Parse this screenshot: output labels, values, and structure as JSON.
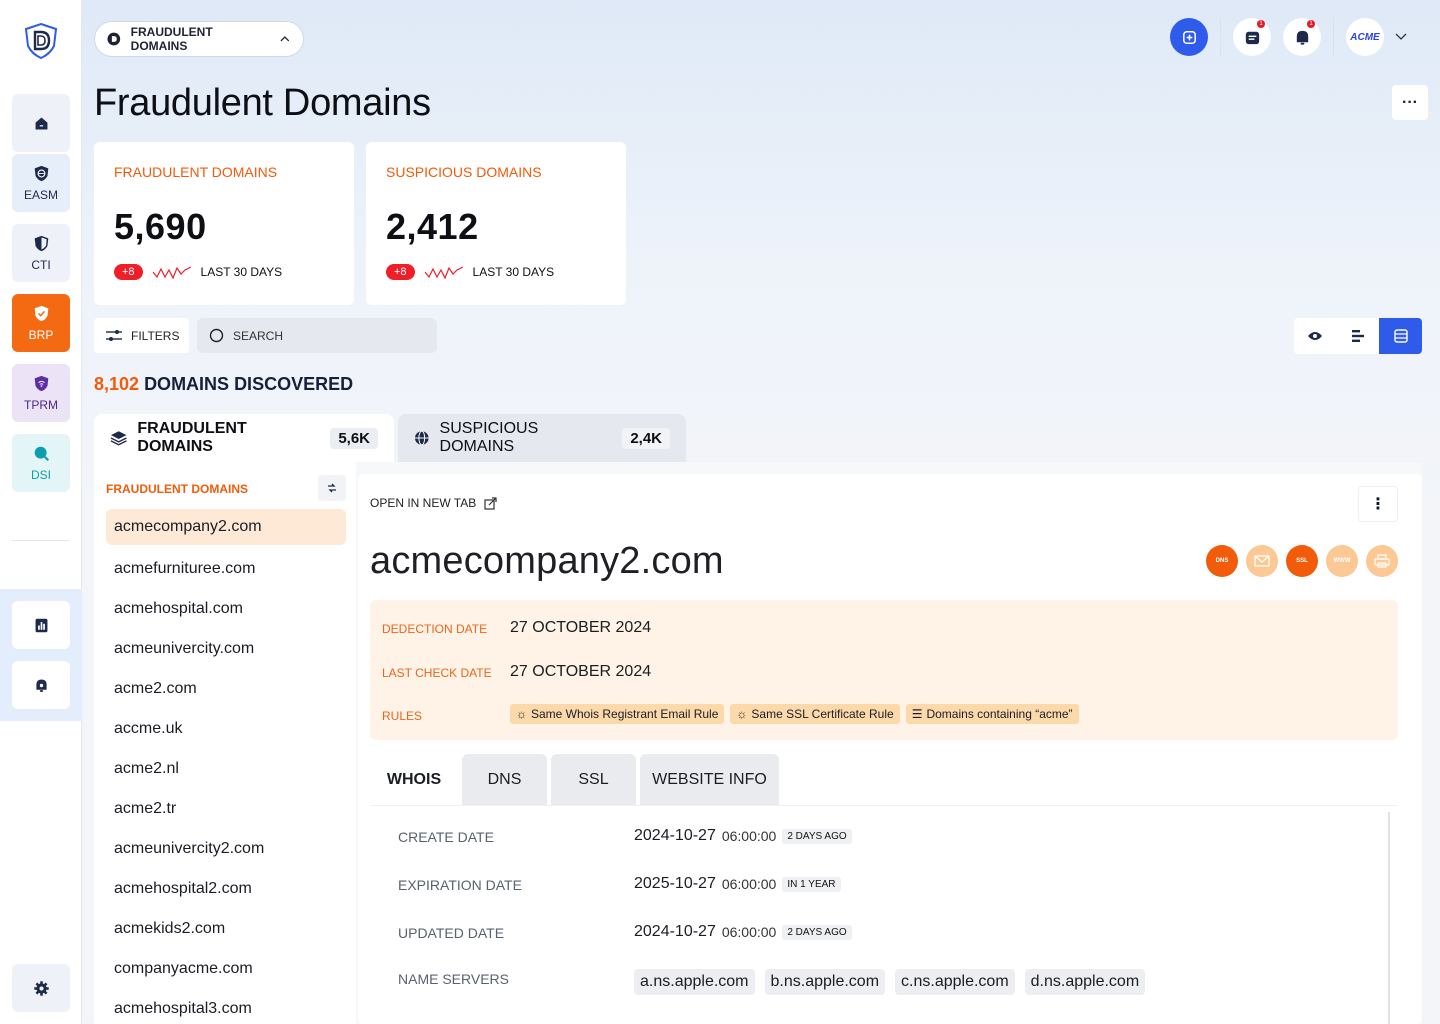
{
  "sidebar": {
    "items": [
      {
        "label": ""
      },
      {
        "label": "EASM"
      },
      {
        "label": "CTI"
      },
      {
        "label": "BRP"
      },
      {
        "label": "TPRM"
      },
      {
        "label": "DSI"
      }
    ]
  },
  "header": {
    "context_label": "FRAUDULENT DOMAINS",
    "notification_count": "1",
    "alert_count": "1",
    "org_logo_text": "ACME",
    "page_title": "Fraudulent Domains"
  },
  "stats": [
    {
      "label": "FRAUDULENT DOMAINS",
      "value": "5,690",
      "delta": "+8",
      "period": "LAST 30 DAYS"
    },
    {
      "label": "SUSPICIOUS DOMAINS",
      "value": "2,412",
      "delta": "+8",
      "period": "LAST 30 DAYS"
    }
  ],
  "toolbar": {
    "filters_label": "FILTERS",
    "search_placeholder": "SEARCH"
  },
  "discovered": {
    "count": "8,102",
    "label": "DOMAINS DISCOVERED"
  },
  "tabs": [
    {
      "label": "FRAUDULENT DOMAINS",
      "count": "5,6K"
    },
    {
      "label": "SUSPICIOUS DOMAINS",
      "count": "2,4K"
    }
  ],
  "list": {
    "heading": "FRAUDULENT DOMAINS",
    "domains": [
      "acmecompany2.com",
      "acmefurnituree.com",
      "acmehospital.com",
      "acmeunivercity.com",
      "acme2.com",
      "accme.uk",
      "acme2.nl",
      "acme2.tr",
      "acmeunivercity2.com",
      "acmehospital2.com",
      "acmekids2.com",
      "companyacme.com",
      "acmehospital3.com"
    ]
  },
  "detail": {
    "open_new_tab": "OPEN IN NEW TAB",
    "domain": "acmecompany2.com",
    "feature_icons": [
      {
        "name": "dns",
        "text": "DNS"
      },
      {
        "name": "mail",
        "text": ""
      },
      {
        "name": "ssl",
        "text": "SSL"
      },
      {
        "name": "www",
        "text": "WWW"
      },
      {
        "name": "print",
        "text": ""
      }
    ],
    "detection_label": "DEDECTION DATE",
    "detection_value": "27 OCTOBER 2024",
    "lastcheck_label": "LAST CHECK DATE",
    "lastcheck_value": "27 OCTOBER 2024",
    "rules_label": "RULES",
    "rules": [
      "Same Whois Registrant Email Rule",
      "Same SSL Certificate Rule",
      "Domains containing “acme”"
    ],
    "subtabs": [
      "WHOIS",
      "DNS",
      "SSL",
      "WEBSITE INFO"
    ],
    "whois": {
      "create_label": "CREATE DATE",
      "create_date": "2024-10-27",
      "create_time": "06:00:00",
      "create_ago": "2 DAYS AGO",
      "expiration_label": "EXPIRATION DATE",
      "expiration_date": "2025-10-27",
      "expiration_time": "06:00:00",
      "expiration_ago": "IN 1 YEAR",
      "updated_label": "UPDATED DATE",
      "updated_date": "2024-10-27",
      "updated_time": "06:00:00",
      "updated_ago": "2 DAYS AGO",
      "ns_label": "NAME SERVERS",
      "name_servers": [
        "a.ns.apple.com",
        "b.ns.apple.com",
        "c.ns.apple.com",
        "d.ns.apple.com"
      ]
    }
  },
  "colors": {
    "accent_orange": "#f25b0a",
    "primary_blue": "#2f5bea",
    "alert_red": "#ef1f2a"
  }
}
